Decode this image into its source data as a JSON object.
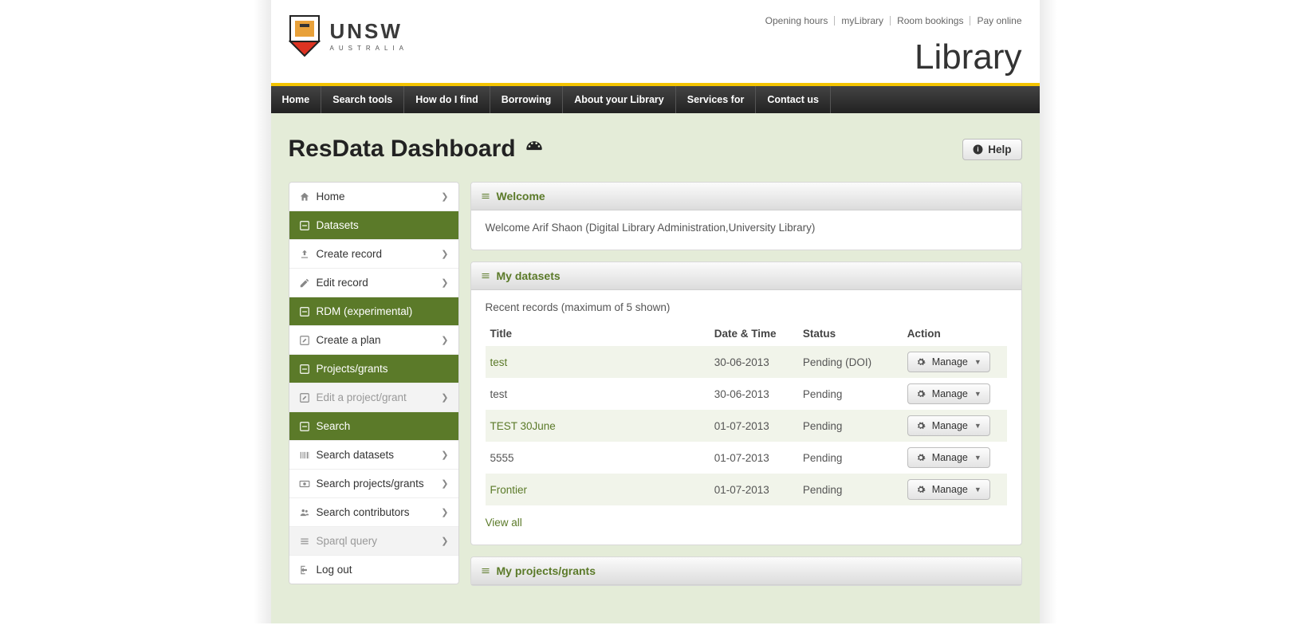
{
  "header": {
    "logo_main": "UNSW",
    "logo_sub": "AUSTRALIA",
    "top_links": [
      "Opening hours",
      "myLibrary",
      "Room bookings",
      "Pay online"
    ],
    "library_word": "Library"
  },
  "nav": [
    "Home",
    "Search tools",
    "How do I find",
    "Borrowing",
    "About your Library",
    "Services for",
    "Contact us"
  ],
  "page": {
    "title": "ResData Dashboard",
    "help": "Help"
  },
  "sidebar": {
    "home": "Home",
    "datasets_head": "Datasets",
    "create_record": "Create record",
    "edit_record": "Edit record",
    "rdm_head": "RDM (experimental)",
    "create_plan": "Create a plan",
    "projects_head": "Projects/grants",
    "edit_project": "Edit a project/grant",
    "search_head": "Search",
    "search_datasets": "Search datasets",
    "search_projects": "Search projects/grants",
    "search_contrib": "Search contributors",
    "sparql": "Sparql query",
    "logout": "Log out"
  },
  "welcome": {
    "head": "Welcome",
    "body": "Welcome Arif Shaon (Digital Library Administration,University Library)"
  },
  "mydatasets": {
    "head": "My datasets",
    "sub": "Recent records (maximum of 5 shown)",
    "columns": {
      "title": "Title",
      "date": "Date & Time",
      "status": "Status",
      "action": "Action"
    },
    "rows": [
      {
        "title": "test",
        "date": "30-06-2013",
        "status": "Pending (DOI)",
        "link": true
      },
      {
        "title": "test",
        "date": "30-06-2013",
        "status": "Pending",
        "link": false
      },
      {
        "title": "TEST 30June",
        "date": "01-07-2013",
        "status": "Pending",
        "link": true
      },
      {
        "title": "5555",
        "date": "01-07-2013",
        "status": "Pending",
        "link": false
      },
      {
        "title": "Frontier",
        "date": "01-07-2013",
        "status": "Pending",
        "link": true
      }
    ],
    "manage": "Manage",
    "view_all": "View all"
  },
  "myprojects": {
    "head": "My projects/grants"
  }
}
